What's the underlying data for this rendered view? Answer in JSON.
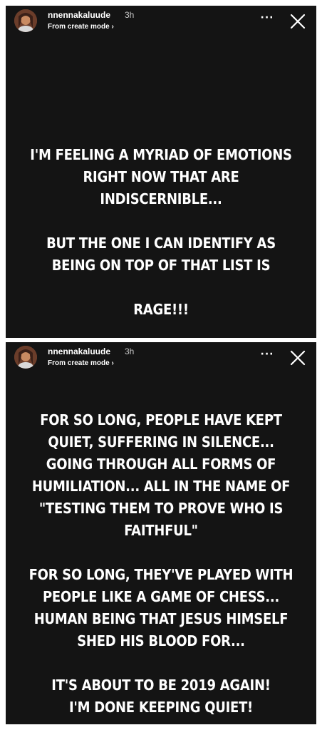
{
  "stories": [
    {
      "username": "nnennakaluude",
      "time": "3h",
      "mode_label": "From create mode",
      "chevron": "›",
      "more_icon": "···",
      "paragraphs": [
        [
          "I'M FEELING A MYRIAD OF EMOTIONS",
          "RIGHT NOW THAT ARE",
          "INDISCERNIBLE..."
        ],
        [
          "BUT THE ONE I CAN IDENTIFY AS",
          "BEING ON TOP OF THAT LIST IS"
        ],
        [
          "RAGE!!!"
        ]
      ]
    },
    {
      "username": "nnennakaluude",
      "time": "3h",
      "mode_label": "From create mode",
      "chevron": "›",
      "more_icon": "···",
      "paragraphs": [
        [
          "FOR SO LONG, PEOPLE HAVE KEPT",
          "QUIET, SUFFERING IN SILENCE...",
          "GOING THROUGH ALL FORMS OF",
          "HUMILIATION... ALL IN THE NAME OF",
          "\"TESTING THEM TO PROVE WHO IS",
          "FAITHFUL\""
        ],
        [
          "FOR SO LONG, THEY'VE PLAYED WITH",
          "PEOPLE LIKE A GAME OF CHESS...",
          "HUMAN BEING THAT JESUS HIMSELF",
          "SHED HIS BLOOD FOR..."
        ],
        [
          "IT'S ABOUT TO BE 2019 AGAIN!",
          "I'M DONE KEEPING QUIET!"
        ]
      ]
    }
  ],
  "colors": {
    "story_background": "#141414",
    "text": "#ffffff",
    "timestamp": "#c8c8c8",
    "page_background": "#ffffff"
  },
  "icons": {
    "avatar": "avatar",
    "more": "more-options-icon",
    "close": "close-icon"
  }
}
